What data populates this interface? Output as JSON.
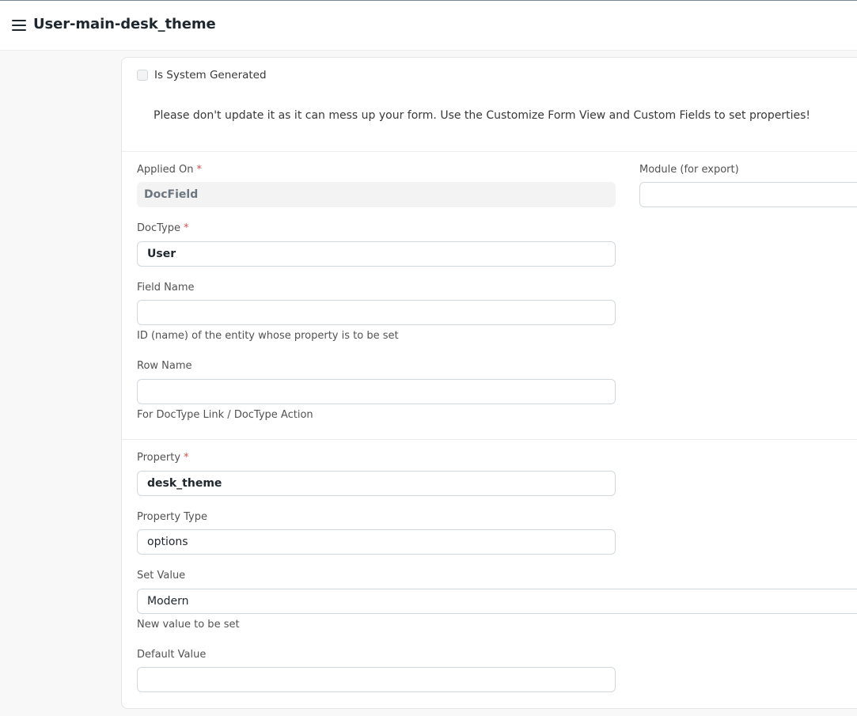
{
  "header": {
    "title": "User-main-desk_theme"
  },
  "flags": {
    "is_system_generated_label": "Is System Generated",
    "is_system_generated_checked": false
  },
  "notice": "Please don't update it as it can mess up your form. Use the Customize Form View and Custom Fields to set properties!",
  "fields": {
    "applied_on": {
      "label": "Applied On",
      "value": "DocField",
      "required": "*"
    },
    "module": {
      "label": "Module (for export)",
      "value": ""
    },
    "doctype": {
      "label": "DocType",
      "value": "User",
      "required": "*"
    },
    "field_name": {
      "label": "Field Name",
      "value": "",
      "help": "ID (name) of the entity whose property is to be set"
    },
    "row_name": {
      "label": "Row Name",
      "value": "",
      "help": "For DocType Link / DocType Action"
    },
    "property": {
      "label": "Property",
      "value": "desk_theme",
      "required": "*"
    },
    "property_type": {
      "label": "Property Type",
      "value": "options"
    },
    "set_value": {
      "label": "Set Value",
      "value": "Modern",
      "help": "New value to be set"
    },
    "default_value": {
      "label": "Default Value",
      "value": ""
    }
  },
  "icons": {
    "menu": "hamburger-menu-icon"
  },
  "colors": {
    "required": "#e24c4c",
    "text": "#1f272e",
    "muted": "#525252"
  }
}
